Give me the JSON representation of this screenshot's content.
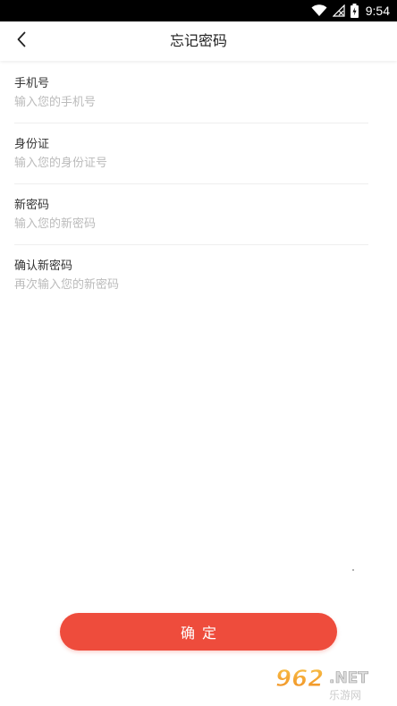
{
  "status_bar": {
    "time": "9:54",
    "icons": [
      "wifi-icon",
      "no-signal-icon",
      "battery-charging-icon"
    ]
  },
  "nav": {
    "title": "忘记密码",
    "back_icon": "chevron-left-icon"
  },
  "form": {
    "fields": [
      {
        "label": "手机号",
        "placeholder": "输入您的手机号",
        "value": ""
      },
      {
        "label": "身份证",
        "placeholder": "输入您的身份证号",
        "value": ""
      },
      {
        "label": "新密码",
        "placeholder": "输入您的新密码",
        "value": ""
      },
      {
        "label": "确认新密码",
        "placeholder": "再次输入您的新密码",
        "value": ""
      }
    ]
  },
  "confirm_button": {
    "label": "确定",
    "color": "#ee4c3c"
  },
  "watermark": {
    "text": "962.NET",
    "subtext": "乐游网"
  }
}
